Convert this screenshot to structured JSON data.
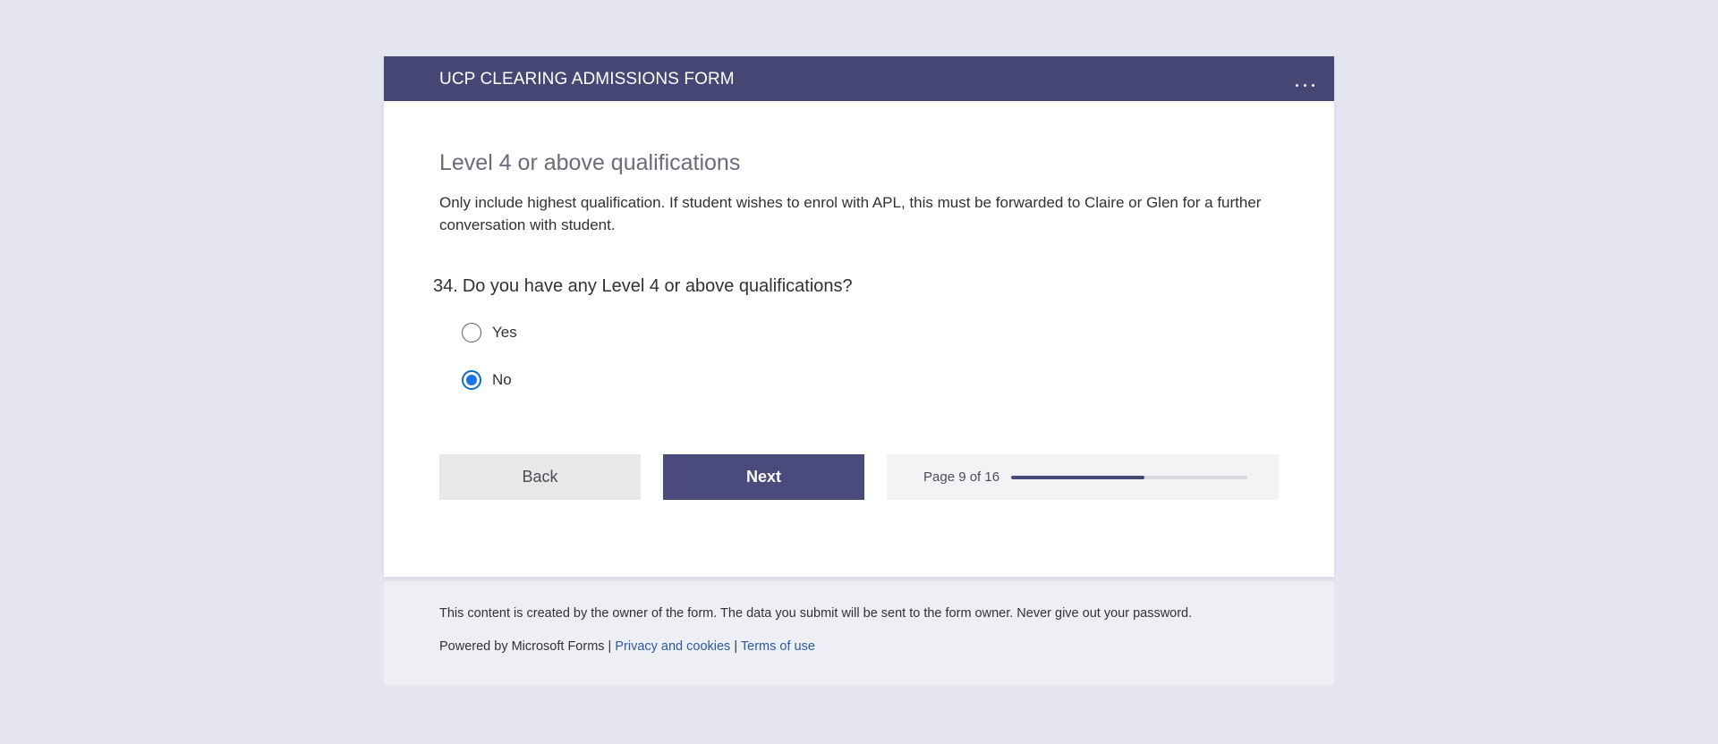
{
  "form": {
    "title": "UCP CLEARING ADMISSIONS FORM",
    "more_icon": "ellipsis-icon"
  },
  "section": {
    "title": "Level 4 or above qualifications",
    "description": "Only include highest qualification.  If student wishes to enrol with APL, this must be forwarded to Claire or Glen for a further conversation with student."
  },
  "question": {
    "number": "34.",
    "text": "Do you have any Level 4 or above qualifications?",
    "options": [
      {
        "label": "Yes",
        "selected": false
      },
      {
        "label": "No",
        "selected": true
      }
    ]
  },
  "navigation": {
    "back_label": "Back",
    "next_label": "Next",
    "page_text": "Page 9 of 16",
    "progress_fraction": 0.5625
  },
  "footer": {
    "disclaimer": "This content is created by the owner of the form. The data you submit will be sent to the form owner. Never give out your password.",
    "powered_by": "Powered by Microsoft Forms |",
    "separator": "|",
    "privacy_link": "Privacy and cookies",
    "terms_link": "Terms of use"
  },
  "colors": {
    "header_bg": "#464775",
    "next_button_bg": "#4a4b7c",
    "radio_selected": "#1a73e8",
    "link": "#2b5aa3",
    "page_bg": "#e6e6f2"
  }
}
